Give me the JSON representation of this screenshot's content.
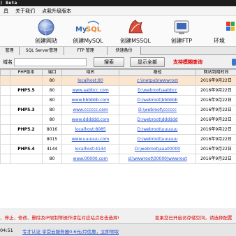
{
  "title": ") Beta",
  "menu": [
    "具",
    "关于我们",
    "点我升级版本"
  ],
  "toolbar": [
    {
      "label": "创建网站",
      "icon": "globe-icon"
    },
    {
      "label": "创建MySQL",
      "icon": "mysql-icon"
    },
    {
      "label": "创建MSSQL",
      "icon": "mssql-icon"
    },
    {
      "label": "创建FTP",
      "icon": "ftp-icon"
    },
    {
      "label": "环境",
      "icon": "environment-icon"
    }
  ],
  "tabs": [
    "管理",
    "SQL Server管理",
    "FTP 管理",
    "快速备份"
  ],
  "domain_bar": {
    "label": "域名",
    "search": "搜索",
    "show_all": "显示全部",
    "hint": "支持模糊查询"
  },
  "table": {
    "headers": [
      "",
      "PHP版本",
      "端口",
      "域名",
      "路径",
      "网站到期时间"
    ],
    "rows": [
      {
        "php": "",
        "port": "80",
        "domain": "localhost:80",
        "path": "c:\\inetpub\\wwwroot",
        "expire": "2016年9月22日",
        "selected": true
      },
      {
        "php": "PHP5.5",
        "port": "80",
        "domain": "www.aabbcc.com",
        "path": "D:\\webroot\\aabbcc",
        "expire": "2016年9月22日",
        "selected": false
      },
      {
        "php": "",
        "port": "80",
        "domain": "www.bbbbbb.com",
        "path": "D:\\webroot\\bbbbbb",
        "expire": "2016年9月22日",
        "selected": false
      },
      {
        "php": "PHP5.3",
        "port": "80",
        "domain": "www.cccccc.com",
        "path": "D:\\webroot\\cccccc",
        "expire": "2016年9月22日",
        "selected": false
      },
      {
        "php": "",
        "port": "80",
        "domain": "www.dddddd.com",
        "path": "D:\\webroot\\dddddd",
        "expire": "2016年9月22日",
        "selected": false
      },
      {
        "php": "PHP5.2",
        "port": "8016",
        "domain": "localhost:8085",
        "path": "D:\\webroot\\uuuuuu",
        "expire": "2016年9月22日",
        "selected": false
      },
      {
        "php": "",
        "port": "8015",
        "domain": "www.uuuuuu.com",
        "path": "D:\\webroot\\uuuuuu",
        "expire": "2016年9月22日",
        "selected": false
      },
      {
        "php": "PHP5.4",
        "port": "4144",
        "domain": "localhost:4144",
        "path": "D:\\webroot\\aaa00000",
        "expire": "2016年9月22日",
        "selected": false
      },
      {
        "php": "",
        "port": "80",
        "domain": "www.00000.com",
        "path": "d:\\wwwroot\\00000\\wwwroot",
        "expire": "2016年9月22日",
        "selected": false
      }
    ]
  },
  "notice_left": "、停止、修改、删除及IP限制等操作请在对应站点右击选择!",
  "notice_right": "如果您已开启访存储空间，请选择配置",
  "status": {
    "time": "04:51",
    "ad": "专才认证  享受云服务器0.6元/月优惠，立即领取"
  },
  "colors": {
    "selected_row": "#fbe5cf",
    "link": "#1d4fd8",
    "warning": "#e00000"
  }
}
